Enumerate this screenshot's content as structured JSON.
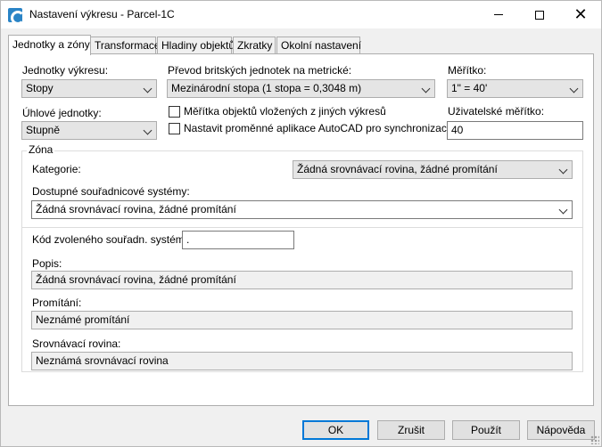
{
  "window": {
    "title": "Nastavení výkresu - Parcel-1C",
    "close_glyph": "✕"
  },
  "tabs": [
    {
      "label": "Jednotky a zóny"
    },
    {
      "label": "Transformace"
    },
    {
      "label": "Hladiny objektů"
    },
    {
      "label": "Zkratky"
    },
    {
      "label": "Okolní nastavení"
    }
  ],
  "units": {
    "drawing_units_label": "Jednotky výkresu:",
    "drawing_units_value": "Stopy",
    "angular_units_label": "Úhlové jednotky:",
    "angular_units_value": "Stupně",
    "imperial_label": "Převod britských jednotek na metrické:",
    "imperial_value": "Mezinárodní stopa (1 stopa = 0,3048 m)",
    "scale_label": "Měřítko:",
    "scale_value": "1\" = 40'",
    "custom_scale_label": "Uživatelské měřítko:",
    "custom_scale_value": "40",
    "scale_objects_label": "Měřítka objektů vložených z jiných výkresů",
    "set_vars_label": "Nastavit proměnné aplikace AutoCAD pro synchronizaci"
  },
  "zone": {
    "group_title": "Zóna",
    "category_label": "Kategorie:",
    "category_value": "Žádná srovnávací rovina, žádné promítání",
    "available_cs_label": "Dostupné souřadnicové systémy:",
    "available_cs_value": "Žádná srovnávací rovina, žádné promítání",
    "cs_code_label": "Kód zvoleného souřadn. systému:",
    "cs_code_value": ".",
    "description_label": "Popis:",
    "description_value": "Žádná srovnávací rovina, žádné promítání",
    "projection_label": "Promítání:",
    "projection_value": "Neznámé promítání",
    "datum_label": "Srovnávací rovina:",
    "datum_value": "Neznámá srovnávací rovina"
  },
  "buttons": {
    "ok": "OK",
    "cancel": "Zrušit",
    "apply": "Použít",
    "help": "Nápověda"
  }
}
